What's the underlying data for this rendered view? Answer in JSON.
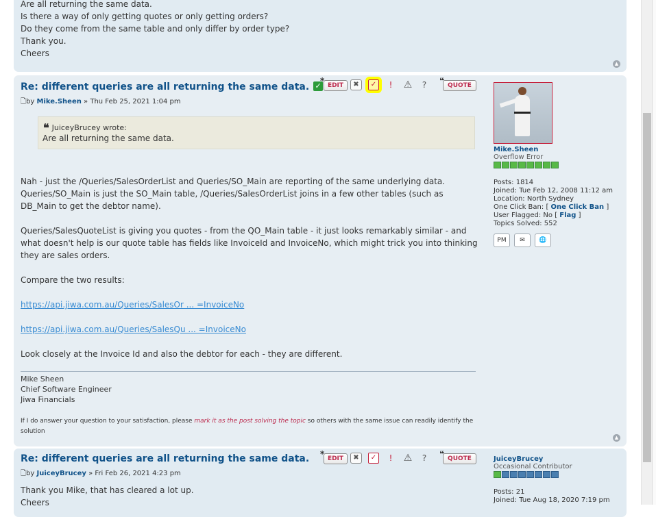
{
  "post1": {
    "lines": [
      "Are all returning the same data.",
      "Is there a way of only getting quotes or only getting orders?",
      "Do they come from the same table and only differ by order type?",
      "Thank you.",
      "Cheers"
    ]
  },
  "toolbar": {
    "edit_label": "EDIT",
    "quote_label": "QUOTE",
    "delete_glyph": "✖",
    "solve_glyph": "✓",
    "report_glyph": "!",
    "warn_glyph": "⚠",
    "info_glyph": "?",
    "star": "*",
    "quote_mark": "❝"
  },
  "post2": {
    "title": "Re: different queries are all returning the same data.",
    "solved_glyph": "✓",
    "by": "by",
    "author": "Mike.Sheen",
    "date": "» Thu Feb 25, 2021 1:04 pm",
    "quote_author": "JuiceyBrucey wrote:",
    "quote_text": "Are all returning the same data.",
    "para1": "Nah - just the /Queries/SalesOrderList and Queries/SO_Main are reporting of the same underlying data. Queries/SO_Main is just the SO_Main table, /Queries/SalesOrderList joins in a few other tables (such as DB_Main to get the debtor name).",
    "para2": "Queries/SalesQuoteList is giving you quotes - from the QO_Main table - it just looks remarkably similar - and what doesn't help is our quote table has fields like InvoiceId and InvoiceNo, which might trick you into thinking they are sales orders.",
    "para3": "Compare the two results:",
    "link1": "https://api.jiwa.com.au/Queries/SalesOr ... =InvoiceNo",
    "link2": "https://api.jiwa.com.au/Queries/SalesQu ... =InvoiceNo",
    "para4": "Look closely at the Invoice Id and also the debtor for each - they are different.",
    "sig1": "Mike Sheen",
    "sig2": "Chief Software Engineer",
    "sig3": "Jiwa Financials",
    "note_a": "If I do answer your question to your satisfaction, please ",
    "note_red": "mark it as the post solving the topic",
    "note_b": " so others with the same issue can readily identify the solution"
  },
  "profile2": {
    "name": "Mike.Sheen",
    "rank": "Overflow Error",
    "posts_label": "Posts:",
    "posts": "1814",
    "joined_label": "Joined:",
    "joined": "Tue Feb 12, 2008 11:12 am",
    "location_label": "Location:",
    "location": "North Sydney",
    "ocb_label": "One Click Ban:",
    "ocb_open": "[",
    "ocb_link": "One Click Ban",
    "ocb_close": "]",
    "flagged_label": "User Flagged:",
    "flagged": "No",
    "flag_open": "[",
    "flag_link": "Flag",
    "flag_close": "]",
    "solved_label": "Topics Solved:",
    "solved": "552",
    "pm_label": "PM"
  },
  "post3": {
    "title": "Re: different queries are all returning the same data.",
    "by": "by",
    "author": "JuiceyBrucey",
    "date": "» Fri Feb 26, 2021 4:23 pm",
    "line1": "Thank you Mike, that has cleared a lot up.",
    "line2": "Cheers"
  },
  "profile3": {
    "name": "JuiceyBrucey",
    "rank": "Occasional Contributor",
    "posts_label": "Posts:",
    "posts": "21",
    "joined_label": "Joined:",
    "joined": "Tue Aug 18, 2020 7:19 pm"
  },
  "colors": {
    "post_bg": "#e1ebf2",
    "title": "#105289",
    "link": "#368ad2",
    "accent_red": "#bc2a4d",
    "highlight": "#ffff00"
  }
}
